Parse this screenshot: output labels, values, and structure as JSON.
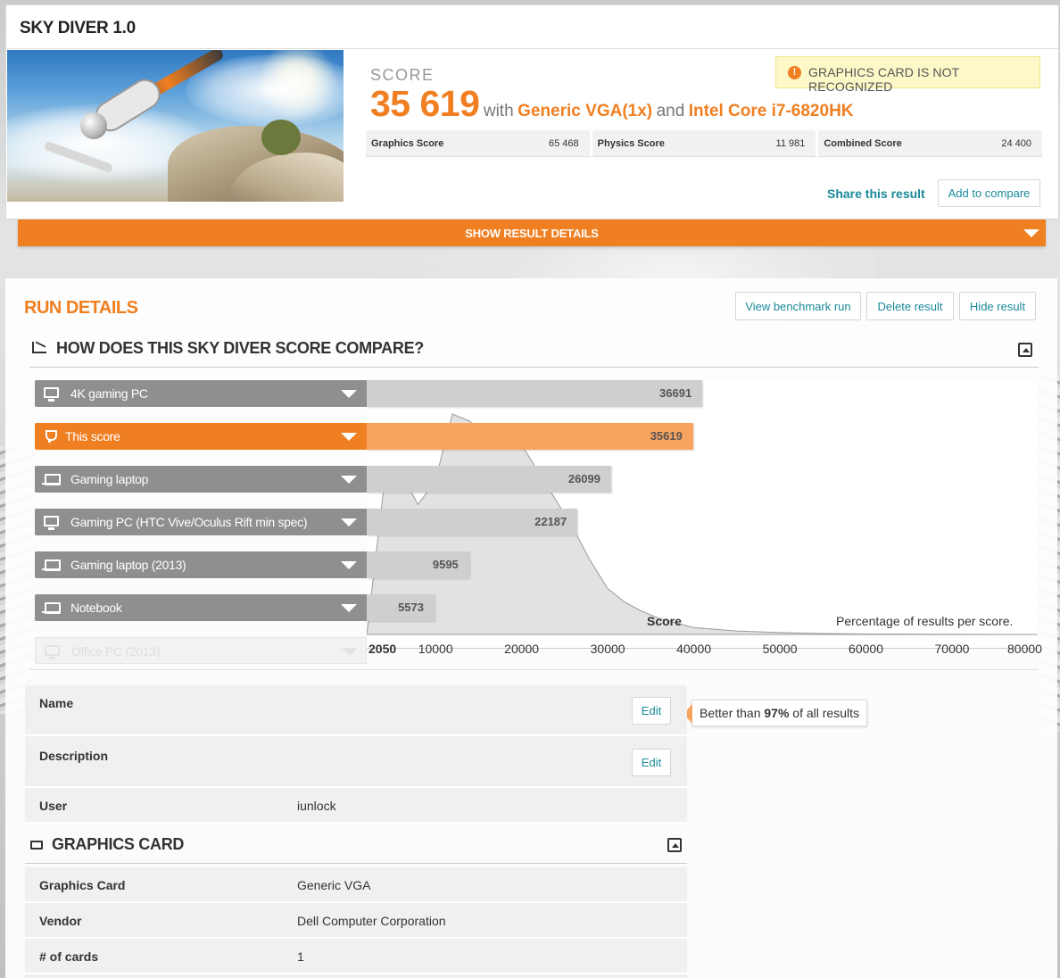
{
  "header": {
    "title": "SKY DIVER 1.0",
    "score_label": "SCORE",
    "score": "35 619",
    "with_text": "with",
    "gpu": "Generic VGA(1x)",
    "and_text": "and",
    "cpu": "Intel Core i7-6820HK",
    "warning": "GRAPHICS CARD IS NOT RECOGNIZED",
    "warning_icon": "!",
    "subscores": [
      {
        "label": "Graphics Score",
        "value": "65 468"
      },
      {
        "label": "Physics Score",
        "value": "11 981"
      },
      {
        "label": "Combined Score",
        "value": "24 400"
      }
    ],
    "share_label": "Share this result",
    "compare_label": "Add to compare",
    "show_details_label": "SHOW RESULT DETAILS"
  },
  "run_details": {
    "title": "RUN DETAILS",
    "buttons": {
      "view": "View benchmark run",
      "delete": "Delete result",
      "hide": "Hide result"
    },
    "compare_title": "HOW DOES THIS SKY DIVER SCORE COMPARE?",
    "rows": [
      {
        "label": "4K gaming PC",
        "value": "36691",
        "icon": "desktop-icon"
      },
      {
        "label": "This score",
        "value": "35619",
        "icon": "trophy-icon"
      },
      {
        "label": "Gaming laptop",
        "value": "26099",
        "icon": "laptop-icon"
      },
      {
        "label": "Gaming PC (HTC Vive/Oculus Rift min spec)",
        "value": "22187",
        "icon": "desktop-icon"
      },
      {
        "label": "Gaming laptop (2013)",
        "value": "9595",
        "icon": "laptop-icon"
      },
      {
        "label": "Notebook",
        "value": "5573",
        "icon": "laptop-icon"
      },
      {
        "label": "Office PC (2013)",
        "value": "",
        "icon": "desktop-icon"
      }
    ],
    "tooltip": {
      "prefix": "Better than ",
      "percent": "97%",
      "suffix": " of all results"
    },
    "axis_title": "Score",
    "percent_label": "Percentage of results per score.",
    "ticks": [
      "2050",
      "10000",
      "20000",
      "30000",
      "40000",
      "50000",
      "60000",
      "70000",
      "80000"
    ]
  },
  "chart_data": {
    "type": "area",
    "xlabel": "Score",
    "ylabel": "Percentage of results per score.",
    "xlim": [
      2050,
      80000
    ],
    "x": [
      2050,
      4000,
      6000,
      8000,
      10000,
      12000,
      14000,
      16000,
      18000,
      20000,
      22000,
      24000,
      26000,
      28000,
      30000,
      32000,
      34000,
      36000,
      38000,
      40000,
      45000,
      50000,
      55000,
      60000,
      70000,
      80000
    ],
    "series": [
      {
        "values": [
          0,
          62,
          70,
          56,
          66,
          95,
          92,
          84,
          90,
          82,
          70,
          58,
          46,
          32,
          20,
          14,
          10,
          7,
          5,
          3,
          1.5,
          0.8,
          0.4,
          0.2,
          0.1,
          0
        ]
      }
    ],
    "comparison_bars": {
      "categories": [
        "4K gaming PC",
        "This score",
        "Gaming laptop",
        "Gaming PC (HTC Vive/Oculus Rift min spec)",
        "Gaming laptop (2013)",
        "Notebook"
      ],
      "values": [
        36691,
        35619,
        26099,
        22187,
        9595,
        5573
      ]
    }
  },
  "details": {
    "rows": [
      {
        "key": "Name",
        "value": "",
        "edit": "Edit"
      },
      {
        "key": "Description",
        "value": "",
        "edit": "Edit"
      },
      {
        "key": "User",
        "value": "iunlock"
      }
    ]
  },
  "graphics_card": {
    "title": "GRAPHICS CARD",
    "rows": [
      {
        "key": "Graphics Card",
        "value": "Generic VGA"
      },
      {
        "key": "Vendor",
        "value": "Dell Computer Corporation"
      },
      {
        "key": "# of cards",
        "value": "1"
      }
    ]
  },
  "colors": {
    "accent": "#f07f21",
    "link": "#1a8a9a",
    "bar": "#cfcfcf",
    "bar_active": "#f8a35e",
    "label_bg": "#8f8f8f"
  }
}
